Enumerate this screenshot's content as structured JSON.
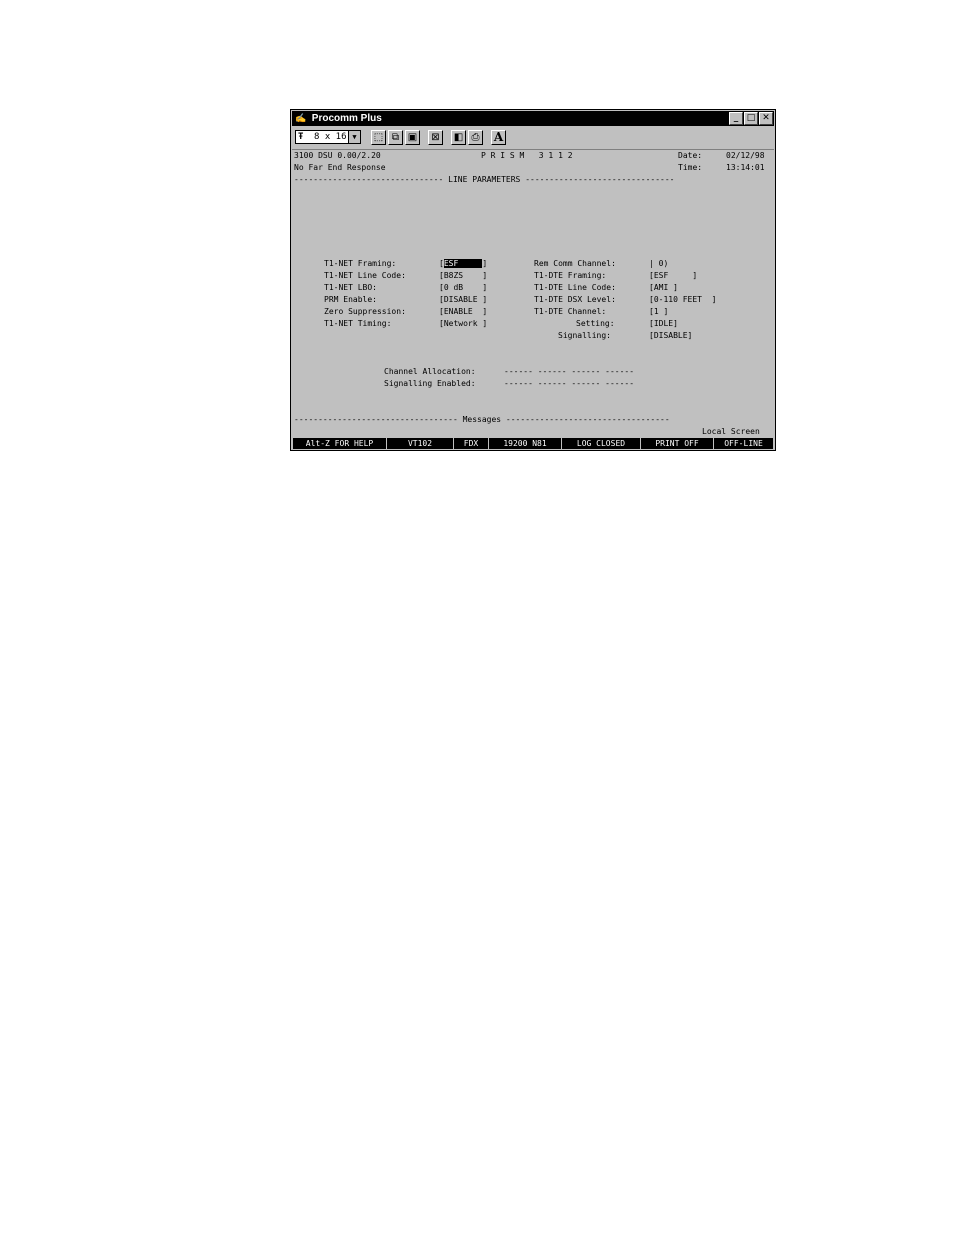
{
  "window": {
    "title": "Procomm Plus",
    "minimize": "_",
    "maximize": "□",
    "close": "✕"
  },
  "toolbar": {
    "font_size": "8 x 16"
  },
  "screen": {
    "header_left_1": "3100 DSU 0.00/2.20",
    "header_center": "P R I S M   3 1 1 2",
    "date_label": "Date:",
    "date_value": "02/12/98",
    "header_left_2": "No Far End Response",
    "time_label": "Time:",
    "time_value": "13:14:01",
    "section_rule": "------------------------------- LINE PARAMETERS -------------------------------",
    "left_fields": [
      {
        "label": "T1-NET Framing:",
        "open": "[",
        "value": "ESF",
        "pad": "     ",
        "close": "]"
      },
      {
        "label": "T1-NET Line Code:",
        "value": "[B8ZS    ]"
      },
      {
        "label": "T1-NET LBO:",
        "value": "[0 dB    ]"
      },
      {
        "label": "PRM Enable:",
        "value": "[DISABLE ]"
      },
      {
        "label": "Zero Suppression:",
        "value": "[ENABLE  ]"
      },
      {
        "label": "T1-NET Timing:",
        "value": "[Network ]"
      }
    ],
    "right_fields": [
      {
        "label": "Rem Comm Channel:",
        "value": "| 0)"
      },
      {
        "label": "T1-DTE Framing:",
        "value": "[ESF     ]"
      },
      {
        "label": "T1-DTE Line Code:",
        "value": "[AMI ]"
      },
      {
        "label": "T1-DTE DSX Level:",
        "value": "[0-110 FEET  ]"
      },
      {
        "label": "T1-DTE Channel:",
        "value": "[1 ]"
      },
      {
        "label": "Setting:",
        "value": "[IDLE]"
      },
      {
        "label": "Signalling:",
        "value": "[DISABLE]"
      }
    ],
    "channel_allocation_label": "Channel Allocation:",
    "channel_allocation_value": "------ ------ ------ ------",
    "signalling_enabled_label": "Signalling Enabled:",
    "signalling_enabled_value": "------ ------ ------ ------",
    "messages_rule": "---------------------------------- Messages ----------------------------------",
    "local_screen": "Local Screen"
  },
  "statusbar": [
    "Alt-Z FOR HELP",
    "VT102",
    "FDX",
    "19200 N81",
    "LOG CLOSED",
    "PRINT OFF",
    "OFF-LINE"
  ]
}
